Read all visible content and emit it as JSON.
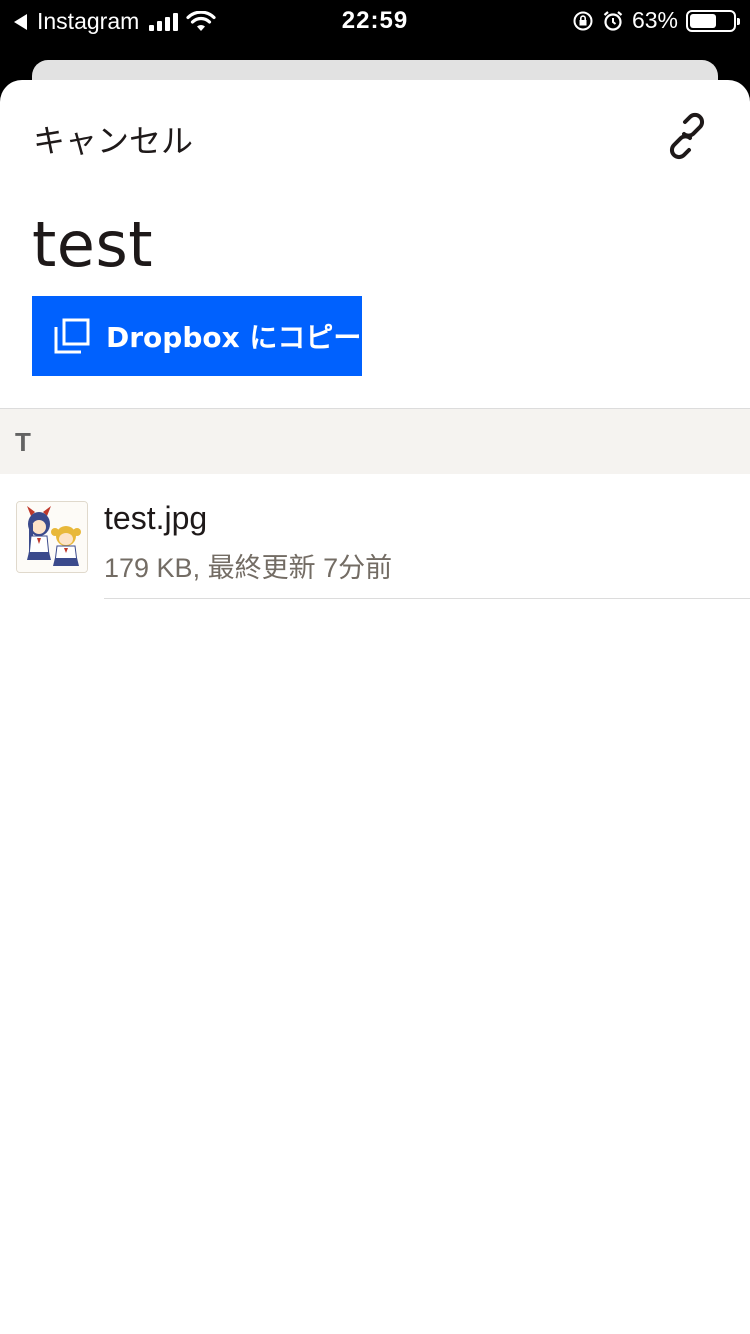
{
  "status_bar": {
    "back_app": "Instagram",
    "time": "22:59",
    "battery_percent": "63%",
    "battery_level": 0.63
  },
  "header": {
    "cancel_label": "キャンセル",
    "link_icon": "link-icon"
  },
  "title": "test",
  "copy_button": {
    "icon": "copy-icon",
    "label": "Dropbox にコピー",
    "color": "#0061fe"
  },
  "section": {
    "letter": "T"
  },
  "files": [
    {
      "name": "test.jpg",
      "meta": "179 KB, 最終更新 7分前",
      "thumbnail": "image-thumbnail"
    }
  ]
}
